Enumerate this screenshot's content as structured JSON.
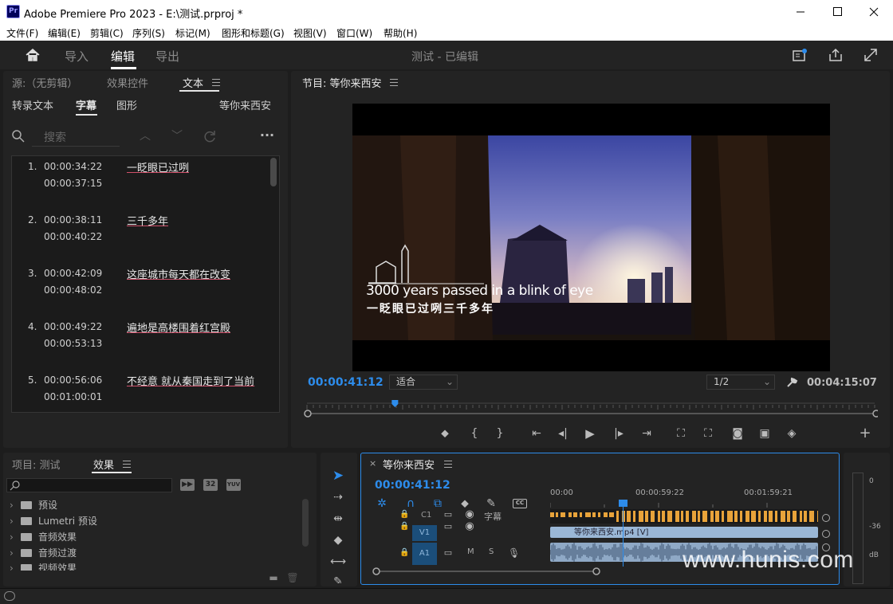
{
  "title_bar": {
    "logo": "Pr",
    "title": "Adobe Premiere Pro 2023 - E:\\测试.prproj *"
  },
  "menu": [
    "文件(F)",
    "编辑(E)",
    "剪辑(C)",
    "序列(S)",
    "标记(M)",
    "图形和标题(G)",
    "视图(V)",
    "窗口(W)",
    "帮助(H)"
  ],
  "header": {
    "tabs": [
      "导入",
      "编辑",
      "导出"
    ],
    "project_status": "测试 - 已编辑"
  },
  "source_panel": {
    "tabs": [
      "源:（无剪辑）",
      "效果控件",
      "文本"
    ],
    "subtabs": [
      "转录文本",
      "字幕",
      "图形"
    ],
    "sequence_name": "等你来西安",
    "search_placeholder": "搜索",
    "captions": [
      {
        "num": "1.",
        "start": "00:00:34:22",
        "end": "00:00:37:15",
        "text": "一眨眼已过咧"
      },
      {
        "num": "2.",
        "start": "00:00:38:11",
        "end": "00:00:40:22",
        "text": "三千多年"
      },
      {
        "num": "3.",
        "start": "00:00:42:09",
        "end": "00:00:48:02",
        "text": "这座城市每天都在改变"
      },
      {
        "num": "4.",
        "start": "00:00:49:22",
        "end": "00:00:53:13",
        "text": "遍地是高楼围着红宫殿"
      },
      {
        "num": "5.",
        "start": "00:00:56:06",
        "end": "00:01:00:01",
        "text": "不经意 就从秦国走到了当前"
      }
    ]
  },
  "program_panel": {
    "title": "节目: 等你来西安",
    "video_caption_en": "3000 years passed in a blink of eye",
    "video_caption_cn": "一眨眼已过咧三千多年",
    "timecode": "00:00:41:12",
    "fit": "适合",
    "resolution": "1/2",
    "duration": "00:04:15:07",
    "playhead_fraction": 0.155
  },
  "project_panel": {
    "tabs": [
      "项目: 测试",
      "效果"
    ],
    "search_placeholder": "",
    "buttons": [
      "32",
      "YUV"
    ],
    "items": [
      "预设",
      "Lumetri 预设",
      "音频效果",
      "音频过渡",
      "视频效果"
    ]
  },
  "timeline_panel": {
    "sequence_name": "等你来西安",
    "timecode": "00:00:41:12",
    "ruler": [
      "00:00",
      "00:00:59:22",
      "00:01:59:21"
    ],
    "caption_track": {
      "label": "C1",
      "name": "字幕"
    },
    "tracks": [
      {
        "label": "V1",
        "clip_name": "等你来西安.mp4 [V]"
      },
      {
        "label": "A1",
        "clip_name": ""
      }
    ],
    "audio_toggles": [
      "M",
      "S"
    ]
  },
  "meter": {
    "labels": [
      "0",
      "-36",
      "dB"
    ]
  },
  "watermark": "www.hunis.com",
  "colors": {
    "accent": "#2d8ceb",
    "caption_clip": "#e8a33a",
    "video_clip": "#9ab7d6",
    "track_label": "#1b4e7a"
  }
}
